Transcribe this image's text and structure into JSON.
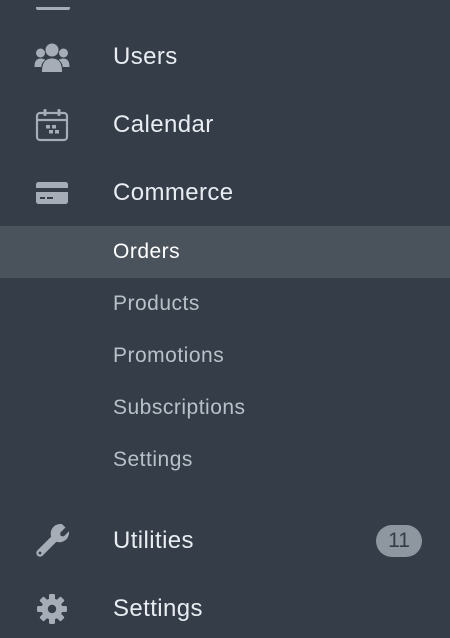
{
  "nav": {
    "users": {
      "label": "Users",
      "icon": "users-icon"
    },
    "calendar": {
      "label": "Calendar",
      "icon": "calendar-icon"
    },
    "commerce": {
      "label": "Commerce",
      "icon": "credit-card-icon",
      "children": [
        {
          "label": "Orders",
          "active": true
        },
        {
          "label": "Products",
          "active": false
        },
        {
          "label": "Promotions",
          "active": false
        },
        {
          "label": "Subscriptions",
          "active": false
        },
        {
          "label": "Settings",
          "active": false
        }
      ]
    },
    "utilities": {
      "label": "Utilities",
      "icon": "wrench-icon",
      "badge": "11"
    },
    "settings": {
      "label": "Settings",
      "icon": "gear-icon"
    }
  },
  "colors": {
    "background": "#343d48",
    "active_background": "#4a525c",
    "icon": "#a6adb6",
    "badge_background": "#8e969f"
  }
}
